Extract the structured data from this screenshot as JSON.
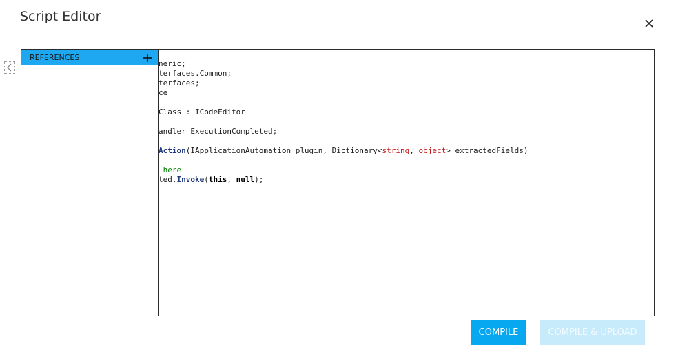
{
  "dialog": {
    "title": "Script Editor"
  },
  "references": {
    "header_label": "REFERENCES"
  },
  "code_lines": [
    [
      {
        "t": "neric;",
        "c": ""
      }
    ],
    [
      {
        "t": "terfaces.Common;",
        "c": ""
      }
    ],
    [
      {
        "t": "terfaces;",
        "c": ""
      }
    ],
    [
      {
        "t": "ce",
        "c": ""
      }
    ],
    [
      {
        "t": "",
        "c": ""
      }
    ],
    [
      {
        "t": "Class : ICodeEditor",
        "c": ""
      }
    ],
    [
      {
        "t": "",
        "c": ""
      }
    ],
    [
      {
        "t": "andler ExecutionCompleted;",
        "c": ""
      }
    ],
    [
      {
        "t": "",
        "c": ""
      }
    ],
    [
      {
        "t": "Action",
        "c": "fn"
      },
      {
        "t": "(IApplicationAutomation plugin, Dictionary<",
        "c": ""
      },
      {
        "t": "string",
        "c": "ty"
      },
      {
        "t": ", ",
        "c": ""
      },
      {
        "t": "object",
        "c": "ty"
      },
      {
        "t": "> extractedFields)",
        "c": ""
      }
    ],
    [
      {
        "t": "",
        "c": ""
      }
    ],
    [
      {
        "t": " here",
        "c": "cm"
      }
    ],
    [
      {
        "t": "ted.",
        "c": ""
      },
      {
        "t": "Invoke",
        "c": "fn"
      },
      {
        "t": "(",
        "c": ""
      },
      {
        "t": "this",
        "c": "kw"
      },
      {
        "t": ", ",
        "c": ""
      },
      {
        "t": "null",
        "c": "kw"
      },
      {
        "t": ");",
        "c": ""
      }
    ]
  ],
  "buttons": {
    "compile": "COMPILE",
    "compile_upload": "COMPILE & UPLOAD"
  },
  "icons": {
    "close": "close-icon",
    "collapse": "chevron-left-icon",
    "add": "plus-icon"
  },
  "colors": {
    "accent": "#08a8f0",
    "header": "#1ea8f1",
    "disabled": "#c7ebfb",
    "type_keyword": "#c31515",
    "comment": "#008000"
  }
}
